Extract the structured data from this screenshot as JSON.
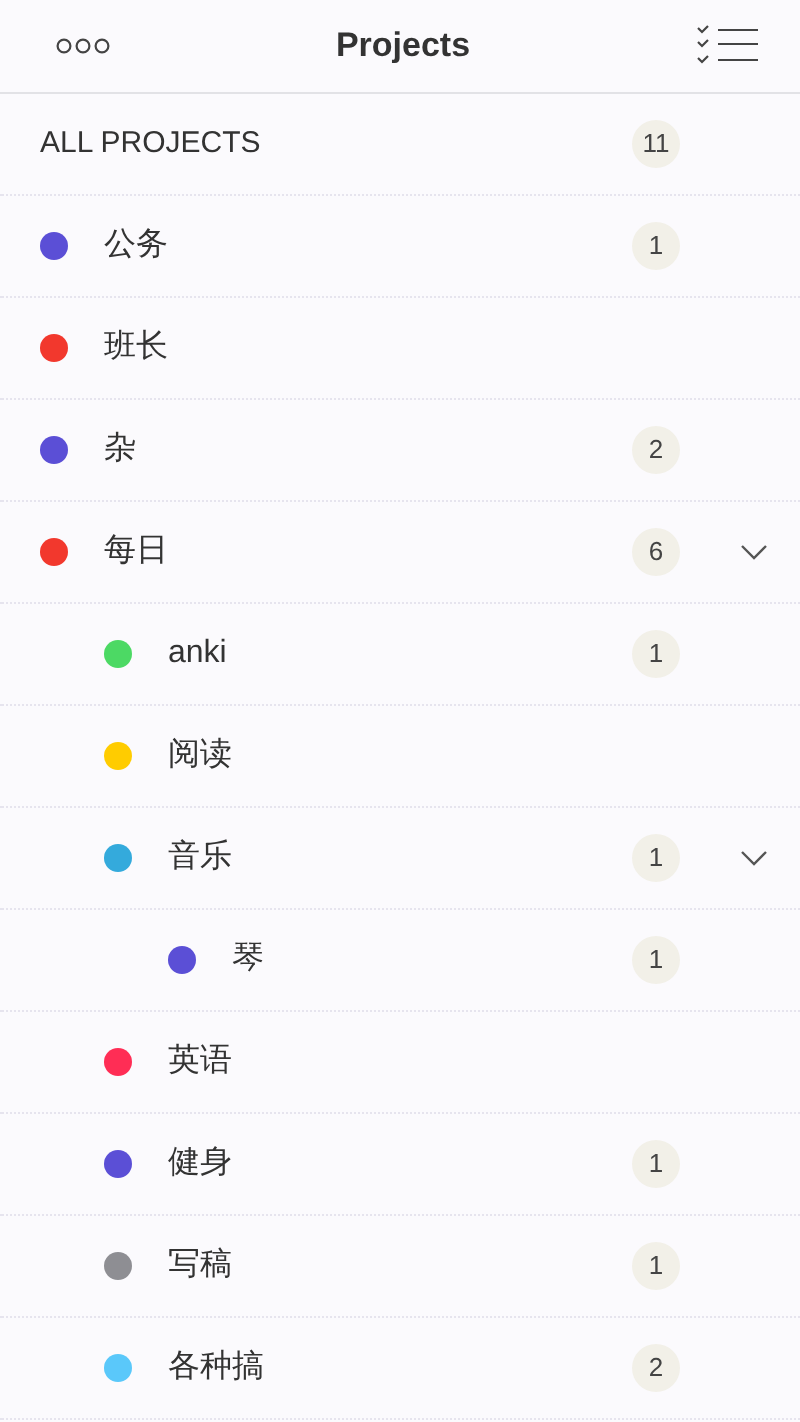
{
  "header": {
    "title": "Projects"
  },
  "all_projects": {
    "label": "ALL PROJECTS",
    "count": "11"
  },
  "projects": [
    {
      "name": "公务",
      "color": "#5b4fd6",
      "count": "1"
    },
    {
      "name": "班长",
      "color": "#f2382d"
    },
    {
      "name": "杂",
      "color": "#5b4fd6",
      "count": "2"
    },
    {
      "name": "每日",
      "color": "#f2382d",
      "count": "6",
      "expanded": true,
      "children": [
        {
          "name": "anki",
          "color": "#4cd964",
          "count": "1"
        },
        {
          "name": "阅读",
          "color": "#ffcc00"
        },
        {
          "name": "音乐",
          "color": "#34aadc",
          "count": "1",
          "expanded": true,
          "children": [
            {
              "name": "琴",
              "color": "#5b4fd6",
              "count": "1"
            }
          ]
        },
        {
          "name": "英语",
          "color": "#ff2d55"
        },
        {
          "name": "健身",
          "color": "#5b4fd6",
          "count": "1"
        },
        {
          "name": "写稿",
          "color": "#8e8e93",
          "count": "1"
        },
        {
          "name": "各种搞",
          "color": "#5ac8fa",
          "count": "2"
        }
      ]
    }
  ]
}
